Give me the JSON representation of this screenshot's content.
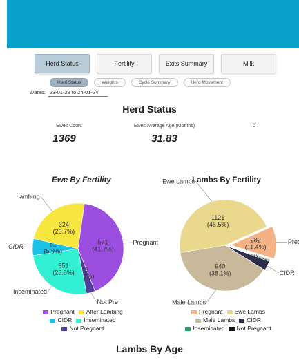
{
  "tabs": [
    {
      "label": "Herd Status",
      "active": true
    },
    {
      "label": "Fertility",
      "active": false
    },
    {
      "label": "Exits Summary",
      "active": false
    },
    {
      "label": "Milk",
      "active": false
    }
  ],
  "subtabs": [
    {
      "label": "Herd Status",
      "active": true
    },
    {
      "label": "Weights",
      "active": false
    },
    {
      "label": "Cycle Summary",
      "active": false
    },
    {
      "label": "Herd Movement",
      "active": false
    }
  ],
  "dates": {
    "label": "Dates:",
    "value": "23-01-23 to 24-01-24"
  },
  "section_title": "Herd Status",
  "stats": [
    {
      "label": "Ewes Count",
      "value": "1369"
    },
    {
      "label": "Ewes Average Age (Months)",
      "value": "31.83"
    },
    {
      "label": "0",
      "value": ""
    }
  ],
  "bottom_title": "Lambs By Age",
  "colors": {
    "banner": "#0aa0cc"
  },
  "chart_data": [
    {
      "type": "pie",
      "title": "Ewe By Fertility",
      "slices": [
        {
          "name": "Pregnant",
          "value": 571,
          "label": "571\n(41.7%)",
          "color": "#9b4ee0",
          "outside": "Pregnant"
        },
        {
          "name": "Not Pregnant",
          "value": 42,
          "label": "42\n(3.1%)",
          "color": "#4f3d9c",
          "outside": "Not Pre"
        },
        {
          "name": "Inseminated",
          "value": 351,
          "label": "351\n(25.6%)",
          "color": "#33f0d2",
          "outside": "Inseminated"
        },
        {
          "name": "CIDR",
          "value": 81,
          "label": "81\n(5.9%)",
          "color": "#19c3e8",
          "outside": "CIDR"
        },
        {
          "name": "After Lambing",
          "value": 324,
          "label": "324\n(23.7%)",
          "color": "#f7e640",
          "outside": "ambing"
        }
      ],
      "legend": [
        "Pregnant",
        "After Lambing",
        "CIDR",
        "Inseminated",
        "Not Pregnant"
      ]
    },
    {
      "type": "pie",
      "title": "Lambs By Fertility",
      "slices": [
        {
          "name": "Pregnant",
          "value": 282,
          "label": "282\n(11.4%)",
          "color": "#f4b183",
          "outside": "Pregnan"
        },
        {
          "name": "Inseminated",
          "value": 8,
          "label": "",
          "color": "#2e9c6a",
          "outside": ""
        },
        {
          "name": "Not Pregnant",
          "value": 8,
          "label": "",
          "color": "#111111",
          "outside": ""
        },
        {
          "name": "CIDR",
          "value": 84,
          "label": "(3.4%)",
          "color": "#2b2d4a",
          "outside": "CIDR"
        },
        {
          "name": "Male Lambs",
          "value": 940,
          "label": "940\n(38.1%)",
          "color": "#c9b99b",
          "outside": "Male Lambs"
        },
        {
          "name": "Ewe Lambs",
          "value": 1121,
          "label": "1121\n(45.5%)",
          "color": "#ead88c",
          "outside": "Ewe Lambs"
        }
      ],
      "legend": [
        "Pregnant",
        "Ewe Lambs",
        "Male Lambs",
        "CIDR",
        "Inseminated",
        "Not Pregnant"
      ]
    }
  ]
}
